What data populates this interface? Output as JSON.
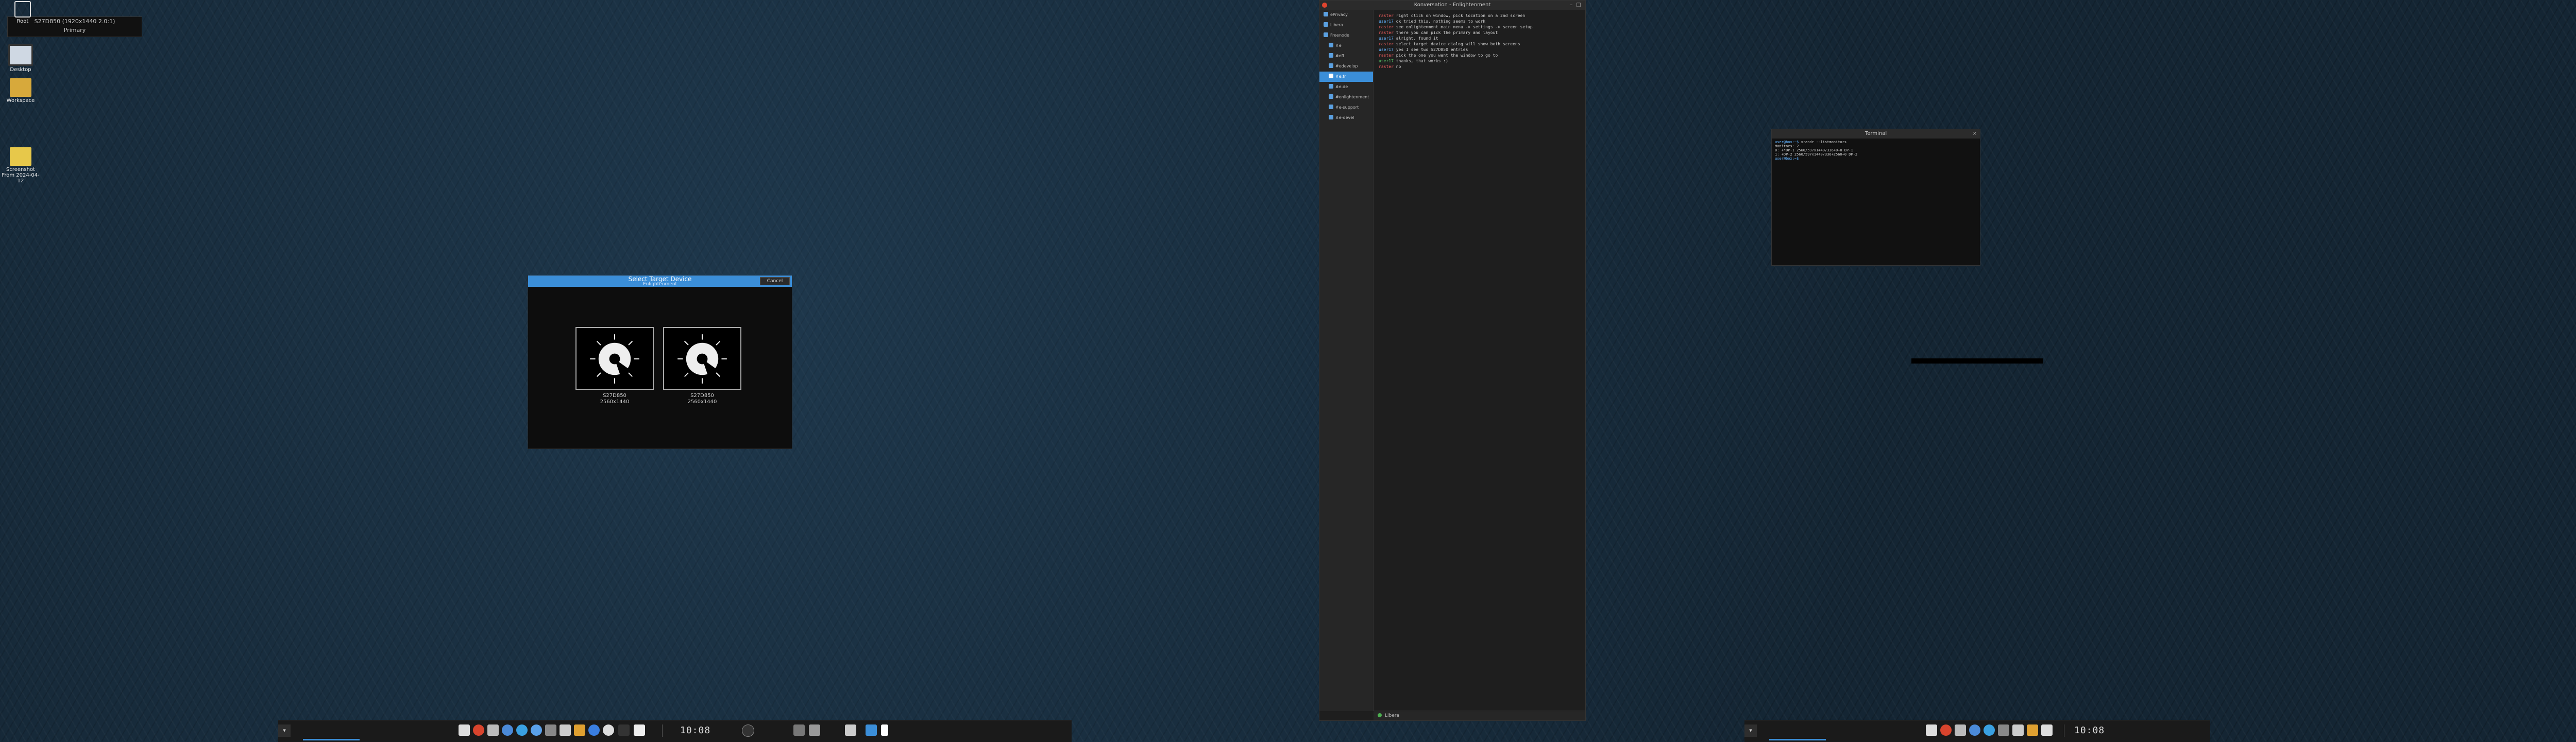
{
  "top_info": {
    "line1": "S27D850 (1920x1440 2.0:1)",
    "line2": "Primary"
  },
  "desktop_icons": [
    {
      "label": "Root"
    },
    {
      "label": "Desktop"
    },
    {
      "label": "Workspace"
    },
    {
      "label": "Screenshot From 2024-04-12"
    }
  ],
  "target_window": {
    "title": "Select Target Device",
    "subtitle": "Enlightenment",
    "cancel": "Cancel",
    "screens": [
      {
        "name": "S27D850",
        "res": "2560x1440"
      },
      {
        "name": "S27D850",
        "res": "2560x1440"
      }
    ]
  },
  "irc_window": {
    "title": "Konversation - Enlightenment",
    "side_nodes": [
      {
        "label": "ePrivacy"
      },
      {
        "label": "Libera"
      },
      {
        "label": "Freenode"
      },
      {
        "label": "#e"
      },
      {
        "label": "#efl"
      },
      {
        "label": "#edevelop"
      },
      {
        "label": "#e.fr"
      },
      {
        "label": "#e.de"
      },
      {
        "label": "#enlightenment"
      },
      {
        "label": "#e-support"
      },
      {
        "label": "#e-devel"
      }
    ],
    "status": "Libera",
    "lines": [
      {
        "nick": "raster",
        "text": "right click on window, pick location on a 2nd screen"
      },
      {
        "nick": "user17",
        "text": "ok tried this, nothing seems to work"
      },
      {
        "nick": "raster",
        "text": "see enlightenment main menu -> settings -> screen setup"
      },
      {
        "nick": "raster",
        "text": "there you can pick the primary and layout"
      },
      {
        "nick": "user17",
        "text": "alright, found it"
      },
      {
        "nick": "raster",
        "text": "select target device dialog will show both screens"
      },
      {
        "nick": "user17",
        "text": "yes I see two S27D850 entries"
      },
      {
        "nick": "raster",
        "text": "pick the one you want the window to go to"
      },
      {
        "nick": "user17",
        "text": "thanks, that works :)"
      },
      {
        "nick": "raster",
        "text": "np"
      }
    ]
  },
  "terminal_window": {
    "title": "Terminal",
    "lines": [
      {
        "prompt": "user@box:~$",
        "text": "xrandr --listmonitors"
      },
      {
        "prompt": "",
        "text": "Monitors: 2"
      },
      {
        "prompt": "",
        "text": " 0: +*DP-1 2560/597x1440/336+0+0  DP-1"
      },
      {
        "prompt": "",
        "text": " 1: +DP-2 2560/597x1440/336+2560+0  DP-2"
      },
      {
        "prompt": "user@box:~$",
        "text": ""
      }
    ]
  },
  "taskbar": {
    "clock_left": "10:08",
    "clock_right": "10:08"
  }
}
